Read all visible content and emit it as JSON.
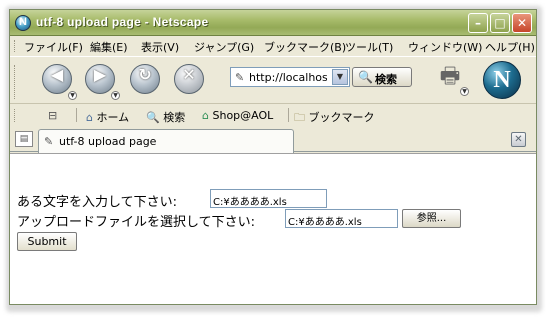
{
  "window": {
    "title": "utf-8 upload page - Netscape",
    "minimize_label": "–",
    "maximize_label": "□",
    "close_label": "✕"
  },
  "menu": {
    "items": [
      {
        "label": "ファイル(F)"
      },
      {
        "label": "編集(E)"
      },
      {
        "label": "表示(V)"
      },
      {
        "label": "ジャンプ(G)"
      },
      {
        "label": "ブックマーク(B)"
      },
      {
        "label": "ツール(T)"
      },
      {
        "label": "ウィンドウ(W)"
      },
      {
        "label": "ヘルプ(H)"
      }
    ]
  },
  "navigation": {
    "back_glyph": "◀",
    "forward_glyph": "▶",
    "reload_glyph": "↻",
    "stop_glyph": "✕",
    "url": "http://localhost",
    "search_label": "検索",
    "logo_letter": "N"
  },
  "personal_toolbar": {
    "home_label": "ホーム",
    "search_label": "検索",
    "shop_label": "Shop@AOL",
    "bookmarks_label": "ブックマーク"
  },
  "tab": {
    "label": "utf-8 upload page"
  },
  "form": {
    "text_label": "ある文字を入力して下さい:",
    "text_value": "C:¥ああああ.xls",
    "file_label": "アップロードファイルを選択して下さい:",
    "file_value": "C:¥ああああ.xls",
    "browse_label": "参照...",
    "submit_label": "Submit"
  },
  "colors": {
    "titlebar": "#a7bb6a",
    "chrome": "#ece9d8",
    "field_border": "#7f9db9"
  }
}
